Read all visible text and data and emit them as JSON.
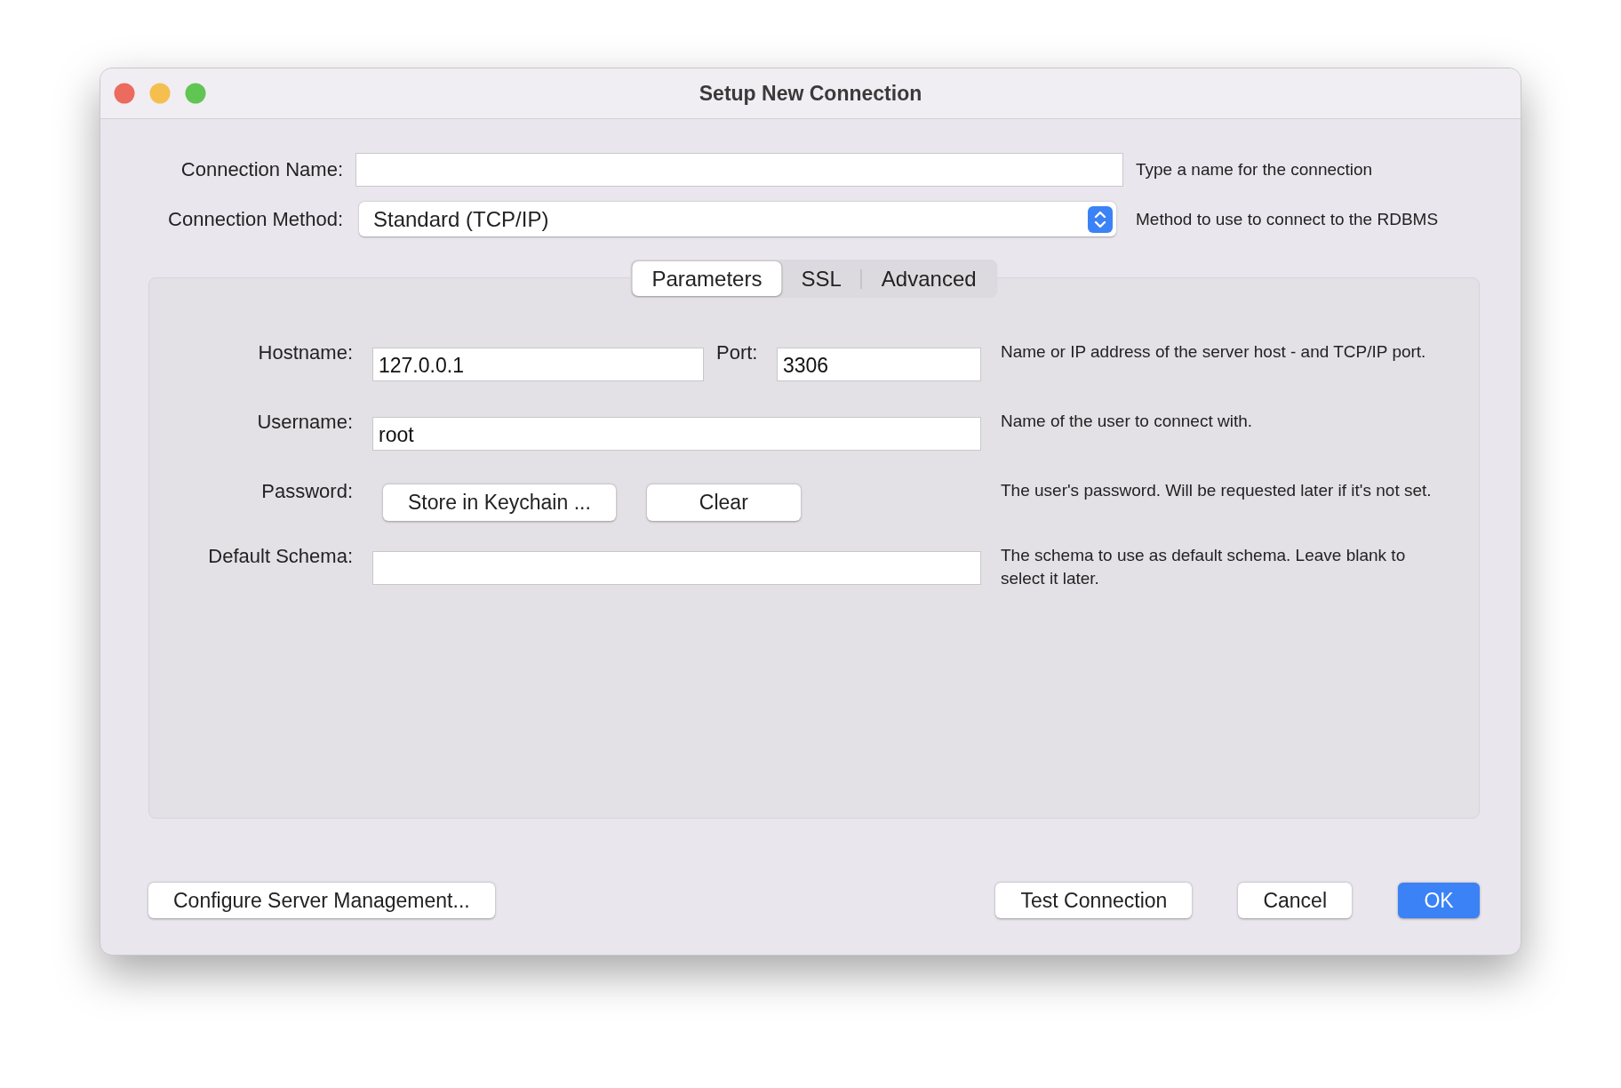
{
  "window": {
    "title": "Setup New Connection"
  },
  "connection_name": {
    "label": "Connection Name:",
    "hint": "Type a name for the connection"
  },
  "connection_method": {
    "label": "Connection Method:",
    "value": "Standard (TCP/IP)",
    "hint": "Method to use to connect to the RDBMS"
  },
  "tabs": [
    {
      "label": "Parameters",
      "selected": true
    },
    {
      "label": "SSL",
      "selected": false
    },
    {
      "label": "Advanced",
      "selected": false
    }
  ],
  "parameters": {
    "hostname": {
      "label": "Hostname:",
      "value": "127.0.0.1"
    },
    "port": {
      "label": "Port:",
      "value": "3306"
    },
    "hostname_hint": "Name or IP address of the server host - and TCP/IP port.",
    "username": {
      "label": "Username:",
      "value": "root",
      "hint": "Name of the user to connect with."
    },
    "password": {
      "label": "Password:",
      "buttons": [
        "Store in Keychain ...",
        "Clear"
      ],
      "hint": "The user's password. Will be requested later if it's not set."
    },
    "default_schema": {
      "label": "Default Schema:",
      "hint": "The schema to use as default schema. Leave blank to select it later."
    }
  },
  "footer_buttons": [
    {
      "label": "Configure Server Management...",
      "kind": "left",
      "default": false
    },
    {
      "label": "Test Connection",
      "kind": "right",
      "default": false
    },
    {
      "label": "Cancel",
      "kind": "right",
      "default": false
    },
    {
      "label": "OK",
      "kind": "right",
      "default": true
    }
  ]
}
